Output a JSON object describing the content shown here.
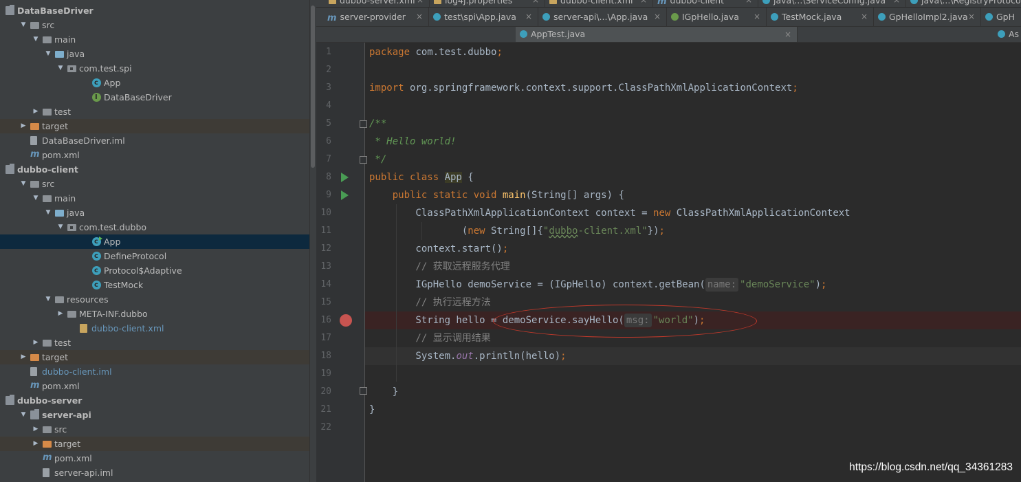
{
  "project_tree": {
    "items": [
      {
        "label": "DataBaseDriver",
        "icon": "module-icon",
        "name": "tree-module-databasedriver"
      },
      {
        "label": "src",
        "icon": "folder-icon",
        "name": "tree-folder-src"
      },
      {
        "label": "main",
        "icon": "folder-icon",
        "name": "tree-folder-main"
      },
      {
        "label": "java",
        "icon": "source-folder-icon",
        "name": "tree-folder-java"
      },
      {
        "label": "com.test.spi",
        "icon": "package-icon",
        "name": "tree-package-com-test-spi"
      },
      {
        "label": "App",
        "icon": "class-icon",
        "name": "tree-class-app"
      },
      {
        "label": "DataBaseDriver",
        "icon": "interface-icon",
        "name": "tree-interface-databasedriver"
      },
      {
        "label": "test",
        "icon": "folder-icon",
        "name": "tree-folder-test"
      },
      {
        "label": "target",
        "icon": "excluded-folder-icon",
        "name": "tree-folder-target"
      },
      {
        "label": "DataBaseDriver.iml",
        "icon": "iml-file-icon",
        "name": "tree-file-databasedriver-iml"
      },
      {
        "label": "pom.xml",
        "icon": "maven-icon",
        "name": "tree-file-pom"
      },
      {
        "label": "dubbo-client",
        "icon": "module-icon",
        "name": "tree-module-dubbo-client"
      },
      {
        "label": "src",
        "icon": "folder-icon",
        "name": "tree-folder-src"
      },
      {
        "label": "main",
        "icon": "folder-icon",
        "name": "tree-folder-main"
      },
      {
        "label": "java",
        "icon": "source-folder-icon",
        "name": "tree-folder-java"
      },
      {
        "label": "com.test.dubbo",
        "icon": "package-icon",
        "name": "tree-package-com-test-dubbo"
      },
      {
        "label": "App",
        "icon": "class-icon",
        "name": "tree-class-app-selected"
      },
      {
        "label": "DefineProtocol",
        "icon": "class-icon",
        "name": "tree-class-defineprotocol"
      },
      {
        "label": "Protocol$Adaptive",
        "icon": "class-icon",
        "name": "tree-class-protocol-adaptive"
      },
      {
        "label": "TestMock",
        "icon": "class-icon",
        "name": "tree-class-testmock"
      },
      {
        "label": "resources",
        "icon": "resources-folder-icon",
        "name": "tree-folder-resources"
      },
      {
        "label": "META-INF.dubbo",
        "icon": "folder-icon",
        "name": "tree-folder-meta-inf-dubbo"
      },
      {
        "label": "dubbo-client.xml",
        "icon": "xml-file-icon",
        "name": "tree-file-dubbo-client-xml"
      },
      {
        "label": "test",
        "icon": "folder-icon",
        "name": "tree-folder-test"
      },
      {
        "label": "target",
        "icon": "excluded-folder-icon",
        "name": "tree-folder-target"
      },
      {
        "label": "dubbo-client.iml",
        "icon": "iml-file-icon",
        "name": "tree-file-dubbo-client-iml"
      },
      {
        "label": "pom.xml",
        "icon": "maven-icon",
        "name": "tree-file-pom"
      },
      {
        "label": "dubbo-server",
        "icon": "module-icon",
        "name": "tree-module-dubbo-server"
      },
      {
        "label": "server-api",
        "icon": "module-icon",
        "name": "tree-module-server-api"
      },
      {
        "label": "src",
        "icon": "folder-icon",
        "name": "tree-folder-src"
      },
      {
        "label": "target",
        "icon": "excluded-folder-icon",
        "name": "tree-folder-target"
      },
      {
        "label": "pom.xml",
        "icon": "maven-icon",
        "name": "tree-file-pom"
      },
      {
        "label": "server-api.iml",
        "icon": "iml-file-icon",
        "name": "tree-file-server-api-iml"
      }
    ]
  },
  "tabs_row1": [
    {
      "label": "dubbo-server.xml",
      "icon": "xml-file-icon"
    },
    {
      "label": "log4j.properties",
      "icon": "properties-file-icon"
    },
    {
      "label": "dubbo-client.xml",
      "icon": "xml-file-icon"
    },
    {
      "label": "dubbo-client",
      "icon": "maven-icon"
    },
    {
      "label": "java\\...\\ServiceConfig.java",
      "icon": "class-icon"
    },
    {
      "label": "java\\...\\RegistryProtocol.ja",
      "icon": "class-icon"
    }
  ],
  "tabs_row2": [
    {
      "label": "server-provider",
      "icon": "maven-icon"
    },
    {
      "label": "test\\spi\\App.java",
      "icon": "class-icon"
    },
    {
      "label": "server-api\\...\\App.java",
      "icon": "class-icon"
    },
    {
      "label": "IGpHello.java",
      "icon": "interface-icon"
    },
    {
      "label": "TestMock.java",
      "icon": "class-icon"
    },
    {
      "label": "GpHelloImpl2.java",
      "icon": "class-icon"
    },
    {
      "label": "GpH",
      "icon": "class-icon"
    }
  ],
  "tabs_row3": [
    {
      "label": "AppTest.java",
      "icon": "class-icon"
    },
    {
      "label": "As",
      "icon": "class-icon"
    }
  ],
  "tab_close_glyph": "×",
  "editor": {
    "line_numbers": [
      "1",
      "2",
      "3",
      "4",
      "5",
      "6",
      "7",
      "8",
      "9",
      "10",
      "11",
      "12",
      "13",
      "14",
      "15",
      "16",
      "17",
      "18",
      "19",
      "20",
      "21",
      "22"
    ],
    "code": {
      "l1_kw": "package",
      "l1_rest": " com.test.dubbo",
      "l1_semi": ";",
      "l3_kw": "import",
      "l3_rest": " org.springframework.context.support.ClassPathXmlApplicationContext",
      "l3_semi": ";",
      "l5": "/**",
      "l6": " * Hello world!",
      "l7": " */",
      "l8_kw": "public class ",
      "l8_name": "App",
      "l8_rest": " {",
      "l9_kw": "    public static void ",
      "l9_fn": "main",
      "l9_rest": "(String[] args) {",
      "l10_a": "        ClassPathXmlApplicationContext context = ",
      "l10_kw": "new",
      "l10_b": " ClassPathXmlApplicationContext",
      "l11_a": "                (",
      "l11_kw": "new",
      "l11_b": " String[]{",
      "l11_str_a": "\"",
      "l11_str_sq": "dubbo",
      "l11_str_b": "-client.xml\"",
      "l11_c": "})",
      "l11_semi": ";",
      "l12_a": "        context.start()",
      "l12_semi": ";",
      "l13": "        // 获取远程服务代理",
      "l14_a": "        IGpHello demoService = (IGpHello) context.getBean(",
      "l14_hint": "name:",
      "l14_str": "\"demoService\"",
      "l14_b": ")",
      "l14_semi": ";",
      "l15": "        // 执行远程方法",
      "l16_a": "        String hello = demoService.sayHello(",
      "l16_hint": "msg:",
      "l16_str": "\"world\"",
      "l16_b": ")",
      "l16_semi": ";",
      "l17": "        // 显示调用结果",
      "l18_a": "        System.",
      "l18_st": "out",
      "l18_b": ".println(hello)",
      "l18_semi": ";",
      "l20": "    }",
      "l21": "}"
    }
  },
  "watermark": "https://blog.csdn.net/qq_34361283",
  "colors": {
    "keyword": "#cc7832",
    "string": "#6a8759",
    "comment": "#629755",
    "breakpoint": "#c75450",
    "annotation_oval": "#c0392b"
  }
}
